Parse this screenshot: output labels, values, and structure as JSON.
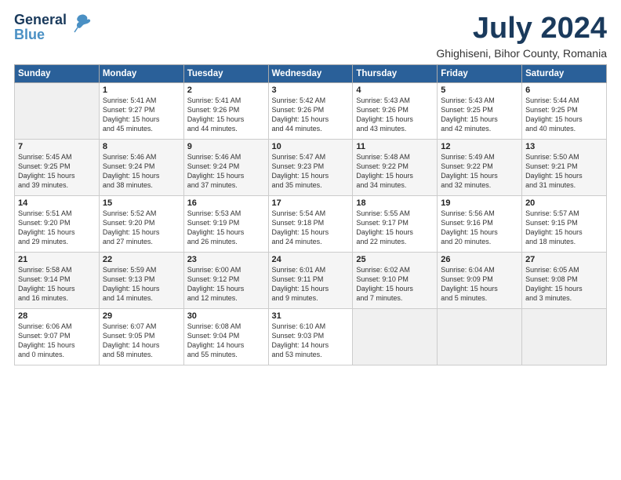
{
  "logo": {
    "line1": "General",
    "line2": "Blue"
  },
  "title": "July 2024",
  "subtitle": "Ghighiseni, Bihor County, Romania",
  "days_header": [
    "Sunday",
    "Monday",
    "Tuesday",
    "Wednesday",
    "Thursday",
    "Friday",
    "Saturday"
  ],
  "weeks": [
    [
      {
        "day": "",
        "content": ""
      },
      {
        "day": "1",
        "content": "Sunrise: 5:41 AM\nSunset: 9:27 PM\nDaylight: 15 hours\nand 45 minutes."
      },
      {
        "day": "2",
        "content": "Sunrise: 5:41 AM\nSunset: 9:26 PM\nDaylight: 15 hours\nand 44 minutes."
      },
      {
        "day": "3",
        "content": "Sunrise: 5:42 AM\nSunset: 9:26 PM\nDaylight: 15 hours\nand 44 minutes."
      },
      {
        "day": "4",
        "content": "Sunrise: 5:43 AM\nSunset: 9:26 PM\nDaylight: 15 hours\nand 43 minutes."
      },
      {
        "day": "5",
        "content": "Sunrise: 5:43 AM\nSunset: 9:25 PM\nDaylight: 15 hours\nand 42 minutes."
      },
      {
        "day": "6",
        "content": "Sunrise: 5:44 AM\nSunset: 9:25 PM\nDaylight: 15 hours\nand 40 minutes."
      }
    ],
    [
      {
        "day": "7",
        "content": "Sunrise: 5:45 AM\nSunset: 9:25 PM\nDaylight: 15 hours\nand 39 minutes."
      },
      {
        "day": "8",
        "content": "Sunrise: 5:46 AM\nSunset: 9:24 PM\nDaylight: 15 hours\nand 38 minutes."
      },
      {
        "day": "9",
        "content": "Sunrise: 5:46 AM\nSunset: 9:24 PM\nDaylight: 15 hours\nand 37 minutes."
      },
      {
        "day": "10",
        "content": "Sunrise: 5:47 AM\nSunset: 9:23 PM\nDaylight: 15 hours\nand 35 minutes."
      },
      {
        "day": "11",
        "content": "Sunrise: 5:48 AM\nSunset: 9:22 PM\nDaylight: 15 hours\nand 34 minutes."
      },
      {
        "day": "12",
        "content": "Sunrise: 5:49 AM\nSunset: 9:22 PM\nDaylight: 15 hours\nand 32 minutes."
      },
      {
        "day": "13",
        "content": "Sunrise: 5:50 AM\nSunset: 9:21 PM\nDaylight: 15 hours\nand 31 minutes."
      }
    ],
    [
      {
        "day": "14",
        "content": "Sunrise: 5:51 AM\nSunset: 9:20 PM\nDaylight: 15 hours\nand 29 minutes."
      },
      {
        "day": "15",
        "content": "Sunrise: 5:52 AM\nSunset: 9:20 PM\nDaylight: 15 hours\nand 27 minutes."
      },
      {
        "day": "16",
        "content": "Sunrise: 5:53 AM\nSunset: 9:19 PM\nDaylight: 15 hours\nand 26 minutes."
      },
      {
        "day": "17",
        "content": "Sunrise: 5:54 AM\nSunset: 9:18 PM\nDaylight: 15 hours\nand 24 minutes."
      },
      {
        "day": "18",
        "content": "Sunrise: 5:55 AM\nSunset: 9:17 PM\nDaylight: 15 hours\nand 22 minutes."
      },
      {
        "day": "19",
        "content": "Sunrise: 5:56 AM\nSunset: 9:16 PM\nDaylight: 15 hours\nand 20 minutes."
      },
      {
        "day": "20",
        "content": "Sunrise: 5:57 AM\nSunset: 9:15 PM\nDaylight: 15 hours\nand 18 minutes."
      }
    ],
    [
      {
        "day": "21",
        "content": "Sunrise: 5:58 AM\nSunset: 9:14 PM\nDaylight: 15 hours\nand 16 minutes."
      },
      {
        "day": "22",
        "content": "Sunrise: 5:59 AM\nSunset: 9:13 PM\nDaylight: 15 hours\nand 14 minutes."
      },
      {
        "day": "23",
        "content": "Sunrise: 6:00 AM\nSunset: 9:12 PM\nDaylight: 15 hours\nand 12 minutes."
      },
      {
        "day": "24",
        "content": "Sunrise: 6:01 AM\nSunset: 9:11 PM\nDaylight: 15 hours\nand 9 minutes."
      },
      {
        "day": "25",
        "content": "Sunrise: 6:02 AM\nSunset: 9:10 PM\nDaylight: 15 hours\nand 7 minutes."
      },
      {
        "day": "26",
        "content": "Sunrise: 6:04 AM\nSunset: 9:09 PM\nDaylight: 15 hours\nand 5 minutes."
      },
      {
        "day": "27",
        "content": "Sunrise: 6:05 AM\nSunset: 9:08 PM\nDaylight: 15 hours\nand 3 minutes."
      }
    ],
    [
      {
        "day": "28",
        "content": "Sunrise: 6:06 AM\nSunset: 9:07 PM\nDaylight: 15 hours\nand 0 minutes."
      },
      {
        "day": "29",
        "content": "Sunrise: 6:07 AM\nSunset: 9:05 PM\nDaylight: 14 hours\nand 58 minutes."
      },
      {
        "day": "30",
        "content": "Sunrise: 6:08 AM\nSunset: 9:04 PM\nDaylight: 14 hours\nand 55 minutes."
      },
      {
        "day": "31",
        "content": "Sunrise: 6:10 AM\nSunset: 9:03 PM\nDaylight: 14 hours\nand 53 minutes."
      },
      {
        "day": "",
        "content": ""
      },
      {
        "day": "",
        "content": ""
      },
      {
        "day": "",
        "content": ""
      }
    ]
  ]
}
